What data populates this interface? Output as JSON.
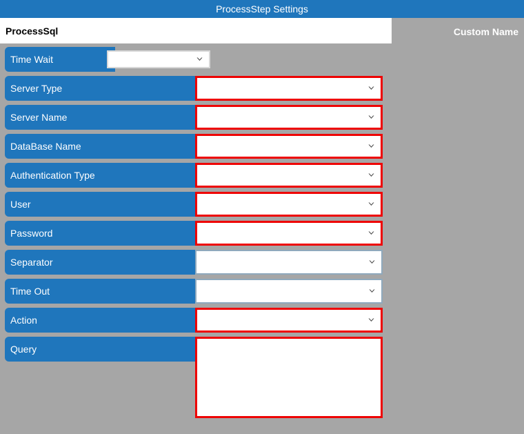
{
  "window": {
    "title": "ProcessStep Settings"
  },
  "header": {
    "name_value": "ProcessSql",
    "name_placeholder": "",
    "custom_name_label": "Custom Name"
  },
  "colors": {
    "accent_blue": "#1f76bc",
    "background_gray": "#a6a6a6",
    "error_red": "#ee0000",
    "field_blue_border": "#8fa9bd",
    "white": "#ffffff"
  },
  "form": {
    "rows": [
      {
        "label": "Time Wait",
        "control": "select",
        "value": "",
        "placeholder": "",
        "border": "plain",
        "icon": "chevron-down-icon",
        "name": "time-wait"
      },
      {
        "label": "Server Type",
        "control": "select",
        "value": "",
        "placeholder": "",
        "border": "red",
        "icon": "chevron-down-icon",
        "name": "server-type"
      },
      {
        "label": "Server Name",
        "control": "select",
        "value": "",
        "placeholder": "",
        "border": "red",
        "icon": "chevron-down-icon",
        "name": "server-name"
      },
      {
        "label": "DataBase Name",
        "control": "select",
        "value": "",
        "placeholder": "",
        "border": "red",
        "icon": "chevron-down-icon",
        "name": "database-name"
      },
      {
        "label": "Authentication Type",
        "control": "select",
        "value": "",
        "placeholder": "",
        "border": "red",
        "icon": "chevron-down-icon",
        "name": "authentication-type"
      },
      {
        "label": "User",
        "control": "select",
        "value": "",
        "placeholder": "",
        "border": "red",
        "icon": "chevron-down-icon",
        "name": "user"
      },
      {
        "label": "Password",
        "control": "select",
        "value": "",
        "placeholder": "",
        "border": "red",
        "icon": "chevron-down-icon",
        "name": "password"
      },
      {
        "label": "Separator",
        "control": "select",
        "value": "",
        "placeholder": "",
        "border": "blue",
        "icon": "chevron-down-icon",
        "name": "separator"
      },
      {
        "label": "Time Out",
        "control": "select",
        "value": "",
        "placeholder": "",
        "border": "blue",
        "icon": "chevron-down-icon",
        "name": "time-out"
      },
      {
        "label": "Action",
        "control": "select",
        "value": "",
        "placeholder": "",
        "border": "red",
        "icon": "chevron-down-icon",
        "name": "action"
      },
      {
        "label": "Query",
        "control": "textarea",
        "value": "",
        "placeholder": "",
        "border": "red",
        "icon": "",
        "name": "query"
      }
    ]
  }
}
